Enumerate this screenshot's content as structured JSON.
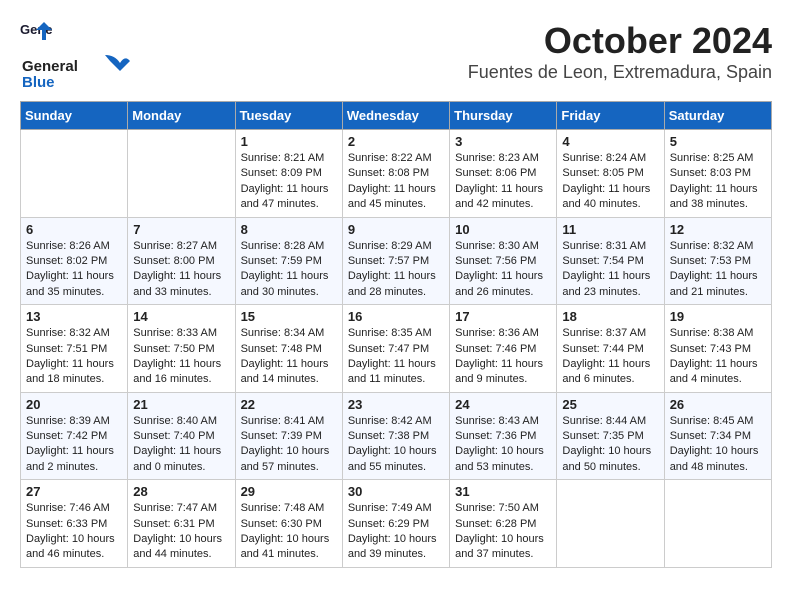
{
  "header": {
    "logo_general": "General",
    "logo_blue": "Blue",
    "month": "October 2024",
    "location": "Fuentes de Leon, Extremadura, Spain"
  },
  "weekdays": [
    "Sunday",
    "Monday",
    "Tuesday",
    "Wednesday",
    "Thursday",
    "Friday",
    "Saturday"
  ],
  "weeks": [
    [
      {
        "day": "",
        "content": ""
      },
      {
        "day": "",
        "content": ""
      },
      {
        "day": "1",
        "content": "Sunrise: 8:21 AM\nSunset: 8:09 PM\nDaylight: 11 hours and 47 minutes."
      },
      {
        "day": "2",
        "content": "Sunrise: 8:22 AM\nSunset: 8:08 PM\nDaylight: 11 hours and 45 minutes."
      },
      {
        "day": "3",
        "content": "Sunrise: 8:23 AM\nSunset: 8:06 PM\nDaylight: 11 hours and 42 minutes."
      },
      {
        "day": "4",
        "content": "Sunrise: 8:24 AM\nSunset: 8:05 PM\nDaylight: 11 hours and 40 minutes."
      },
      {
        "day": "5",
        "content": "Sunrise: 8:25 AM\nSunset: 8:03 PM\nDaylight: 11 hours and 38 minutes."
      }
    ],
    [
      {
        "day": "6",
        "content": "Sunrise: 8:26 AM\nSunset: 8:02 PM\nDaylight: 11 hours and 35 minutes."
      },
      {
        "day": "7",
        "content": "Sunrise: 8:27 AM\nSunset: 8:00 PM\nDaylight: 11 hours and 33 minutes."
      },
      {
        "day": "8",
        "content": "Sunrise: 8:28 AM\nSunset: 7:59 PM\nDaylight: 11 hours and 30 minutes."
      },
      {
        "day": "9",
        "content": "Sunrise: 8:29 AM\nSunset: 7:57 PM\nDaylight: 11 hours and 28 minutes."
      },
      {
        "day": "10",
        "content": "Sunrise: 8:30 AM\nSunset: 7:56 PM\nDaylight: 11 hours and 26 minutes."
      },
      {
        "day": "11",
        "content": "Sunrise: 8:31 AM\nSunset: 7:54 PM\nDaylight: 11 hours and 23 minutes."
      },
      {
        "day": "12",
        "content": "Sunrise: 8:32 AM\nSunset: 7:53 PM\nDaylight: 11 hours and 21 minutes."
      }
    ],
    [
      {
        "day": "13",
        "content": "Sunrise: 8:32 AM\nSunset: 7:51 PM\nDaylight: 11 hours and 18 minutes."
      },
      {
        "day": "14",
        "content": "Sunrise: 8:33 AM\nSunset: 7:50 PM\nDaylight: 11 hours and 16 minutes."
      },
      {
        "day": "15",
        "content": "Sunrise: 8:34 AM\nSunset: 7:48 PM\nDaylight: 11 hours and 14 minutes."
      },
      {
        "day": "16",
        "content": "Sunrise: 8:35 AM\nSunset: 7:47 PM\nDaylight: 11 hours and 11 minutes."
      },
      {
        "day": "17",
        "content": "Sunrise: 8:36 AM\nSunset: 7:46 PM\nDaylight: 11 hours and 9 minutes."
      },
      {
        "day": "18",
        "content": "Sunrise: 8:37 AM\nSunset: 7:44 PM\nDaylight: 11 hours and 6 minutes."
      },
      {
        "day": "19",
        "content": "Sunrise: 8:38 AM\nSunset: 7:43 PM\nDaylight: 11 hours and 4 minutes."
      }
    ],
    [
      {
        "day": "20",
        "content": "Sunrise: 8:39 AM\nSunset: 7:42 PM\nDaylight: 11 hours and 2 minutes."
      },
      {
        "day": "21",
        "content": "Sunrise: 8:40 AM\nSunset: 7:40 PM\nDaylight: 11 hours and 0 minutes."
      },
      {
        "day": "22",
        "content": "Sunrise: 8:41 AM\nSunset: 7:39 PM\nDaylight: 10 hours and 57 minutes."
      },
      {
        "day": "23",
        "content": "Sunrise: 8:42 AM\nSunset: 7:38 PM\nDaylight: 10 hours and 55 minutes."
      },
      {
        "day": "24",
        "content": "Sunrise: 8:43 AM\nSunset: 7:36 PM\nDaylight: 10 hours and 53 minutes."
      },
      {
        "day": "25",
        "content": "Sunrise: 8:44 AM\nSunset: 7:35 PM\nDaylight: 10 hours and 50 minutes."
      },
      {
        "day": "26",
        "content": "Sunrise: 8:45 AM\nSunset: 7:34 PM\nDaylight: 10 hours and 48 minutes."
      }
    ],
    [
      {
        "day": "27",
        "content": "Sunrise: 7:46 AM\nSunset: 6:33 PM\nDaylight: 10 hours and 46 minutes."
      },
      {
        "day": "28",
        "content": "Sunrise: 7:47 AM\nSunset: 6:31 PM\nDaylight: 10 hours and 44 minutes."
      },
      {
        "day": "29",
        "content": "Sunrise: 7:48 AM\nSunset: 6:30 PM\nDaylight: 10 hours and 41 minutes."
      },
      {
        "day": "30",
        "content": "Sunrise: 7:49 AM\nSunset: 6:29 PM\nDaylight: 10 hours and 39 minutes."
      },
      {
        "day": "31",
        "content": "Sunrise: 7:50 AM\nSunset: 6:28 PM\nDaylight: 10 hours and 37 minutes."
      },
      {
        "day": "",
        "content": ""
      },
      {
        "day": "",
        "content": ""
      }
    ]
  ]
}
